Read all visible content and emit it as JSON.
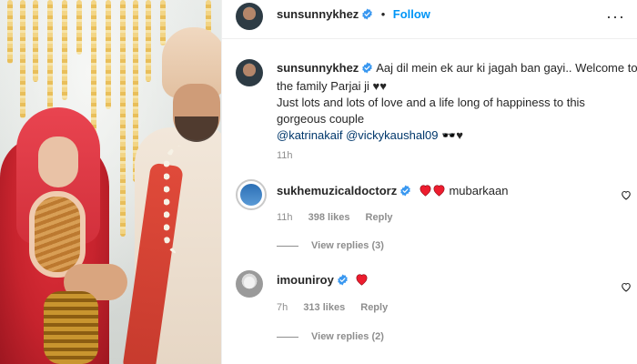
{
  "post": {
    "author": "sunsunnykhez",
    "follow_label": "Follow",
    "separator": "•",
    "more_label": "···"
  },
  "caption": {
    "author": "sunsunnykhez",
    "line1": "Aaj dil mein ek aur ki jagah ban gayi.. Welcome to",
    "line2": "the family Parjai ji ♥♥",
    "line3": "Just lots and lots of love and a life long of happiness to this",
    "line4": "gorgeous couple",
    "mention1": "@katrinakaif",
    "mention2": "@vickykaushal09",
    "emoji": "🕶️♥",
    "time": "11h"
  },
  "comments": [
    {
      "author": "sukhemuzicaldoctorz",
      "text": "mubarkaan",
      "time": "11h",
      "likes": "398 likes",
      "reply_label": "Reply",
      "view_replies": "View replies (3)"
    },
    {
      "author": "imouniroy",
      "text": "",
      "time": "7h",
      "likes": "313 likes",
      "reply_label": "Reply",
      "view_replies": "View replies (2)"
    }
  ],
  "colors": {
    "link_blue": "#0095f6",
    "verified_blue": "#3897f0",
    "heart_red": "#ed4956",
    "muted_text": "#8e8e8e"
  },
  "icons": [
    "verified-badge-icon",
    "more-options-icon",
    "heart-emoji-icon",
    "like-heart-icon"
  ]
}
